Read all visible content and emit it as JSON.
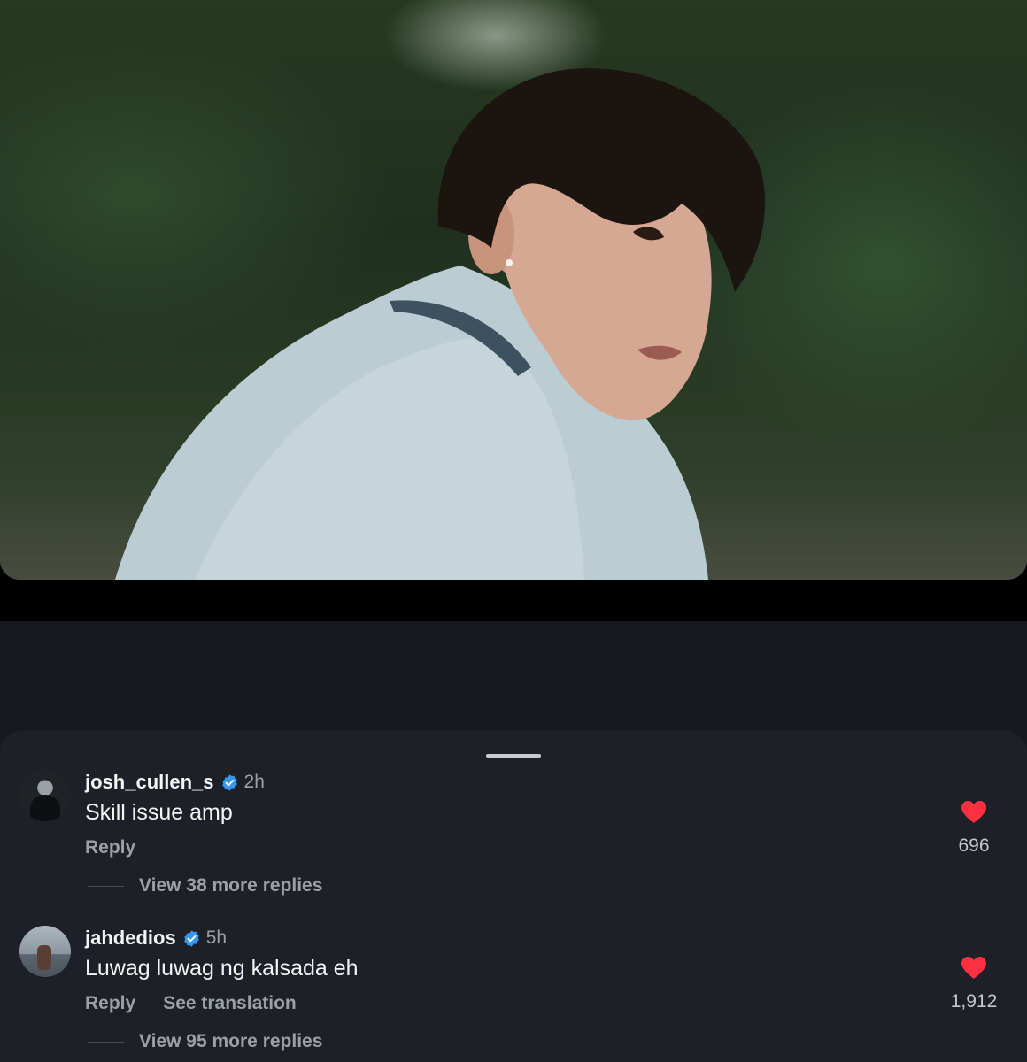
{
  "colors": {
    "sheet_background": "#1d2127",
    "page_background": "#161a1f",
    "heart": "#ff3040",
    "verified": "#3897f0",
    "secondary_text": "#9aa0a6"
  },
  "media": {
    "description_icon": "video-still"
  },
  "comments": [
    {
      "username": "josh_cullen_s",
      "verified": true,
      "time": "2h",
      "text": "Skill issue amp",
      "actions": {
        "reply": "Reply"
      },
      "likes": "696",
      "view_replies": "View 38 more replies"
    },
    {
      "username": "jahdedios",
      "verified": true,
      "time": "5h",
      "text": "Luwag luwag ng kalsada eh",
      "actions": {
        "reply": "Reply",
        "translate": "See translation"
      },
      "likes": "1,912",
      "view_replies": "View 95 more replies"
    }
  ]
}
